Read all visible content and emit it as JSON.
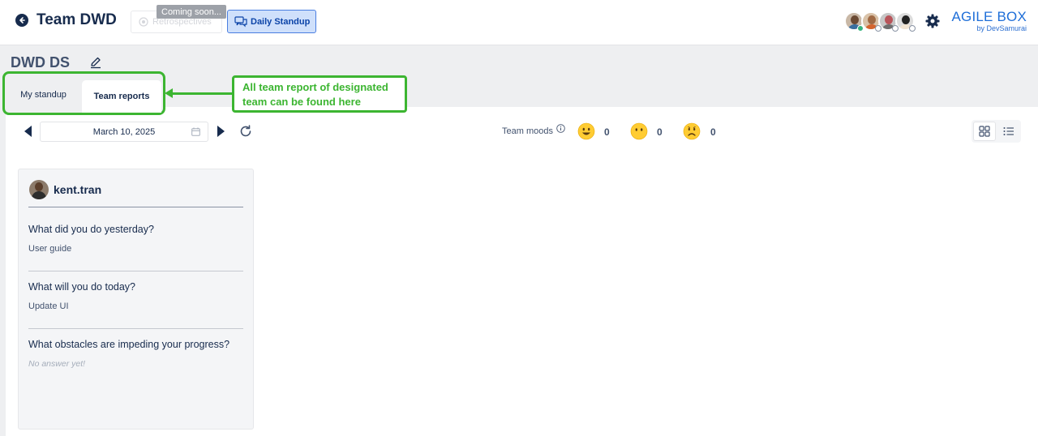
{
  "header": {
    "team_title": "Team DWD",
    "tabs": {
      "retrospectives": "Retrospectives",
      "coming_soon": "Coming soon...",
      "daily_standup": "Daily Standup"
    },
    "brand": {
      "name": "AGILE BOX",
      "by": "by DevSamurai"
    }
  },
  "project": {
    "title": "DWD DS"
  },
  "subtabs": {
    "my_standup": "My standup",
    "team_reports": "Team reports",
    "active": "team_reports"
  },
  "annotation": {
    "line1": "All team report of designated",
    "line2": "team can be found here"
  },
  "toolbar": {
    "date": "March 10, 2025",
    "team_moods_label": "Team moods",
    "moods": [
      {
        "icon": "happy-face-icon",
        "count": "0"
      },
      {
        "icon": "neutral-face-icon",
        "count": "0"
      },
      {
        "icon": "sad-face-icon",
        "count": "0"
      }
    ]
  },
  "report_card": {
    "user": "kent.tran",
    "questions": [
      {
        "q": "What did you do yesterday?",
        "a": "User guide"
      },
      {
        "q": "What will you do today?",
        "a": "Update UI"
      },
      {
        "q": "What obstacles are impeding your progress?",
        "a": "No answer yet!"
      }
    ]
  },
  "colors": {
    "accent": "#1e6ed8",
    "annotation": "#3cb531",
    "active_tab_bg": "#cfe0fb"
  }
}
